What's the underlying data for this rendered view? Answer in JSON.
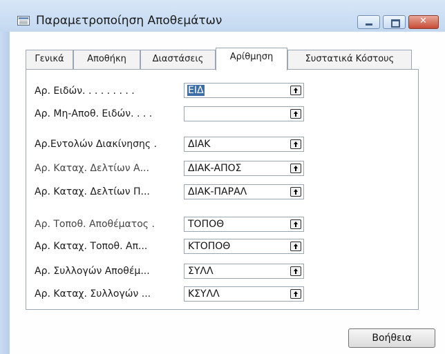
{
  "window": {
    "title": "Παραμετροποίηση Αποθεμάτων"
  },
  "tabs": [
    {
      "label": "Γενικά"
    },
    {
      "label": "Αποθήκη"
    },
    {
      "label": "Διαστάσεις"
    },
    {
      "label": "Αρίθμηση",
      "active": true
    },
    {
      "label": "Συστατικά Κόστους"
    }
  ],
  "fields": [
    {
      "label": "Αρ. Ειδών. . . . . . . . .",
      "value": "ΕΙΔ"
    },
    {
      "label": "Αρ. Μη-Αποθ. Ειδών. . . .",
      "value": ""
    },
    {
      "label": "Αρ.Εντολών Διακίνησης .",
      "value": "ΔΙΑΚ"
    },
    {
      "label": "Αρ. Καταχ. Δελτίων Α...",
      "value": "ΔΙΑΚ-ΑΠΟΣ"
    },
    {
      "label": "Αρ. Καταχ.  Δελτίων Π...",
      "value": "ΔΙΑΚ-ΠΑΡΑΛ"
    },
    {
      "label": "Αρ. Τοποθ. Αποθέματος .",
      "value": "ΤΟΠΟΘ"
    },
    {
      "label": "Αρ. Καταχ. Τοποθ. Απ...",
      "value": "ΚΤΟΠΟΘ"
    },
    {
      "label": "Αρ. Συλλογών Αποθέμ...",
      "value": "ΣΥΛΛ"
    },
    {
      "label": "Αρ. Καταχ. Συλλογών ...",
      "value": "ΚΣΥΛΛ"
    }
  ],
  "buttons": {
    "help": "Βοήθεια"
  },
  "icons": {
    "app": "form-icon",
    "lookup": "lookup-arrow-icon"
  },
  "colors": {
    "titlebar": "#c8dcf2",
    "selection": "#3a6ea5",
    "close": "#c74a35"
  }
}
